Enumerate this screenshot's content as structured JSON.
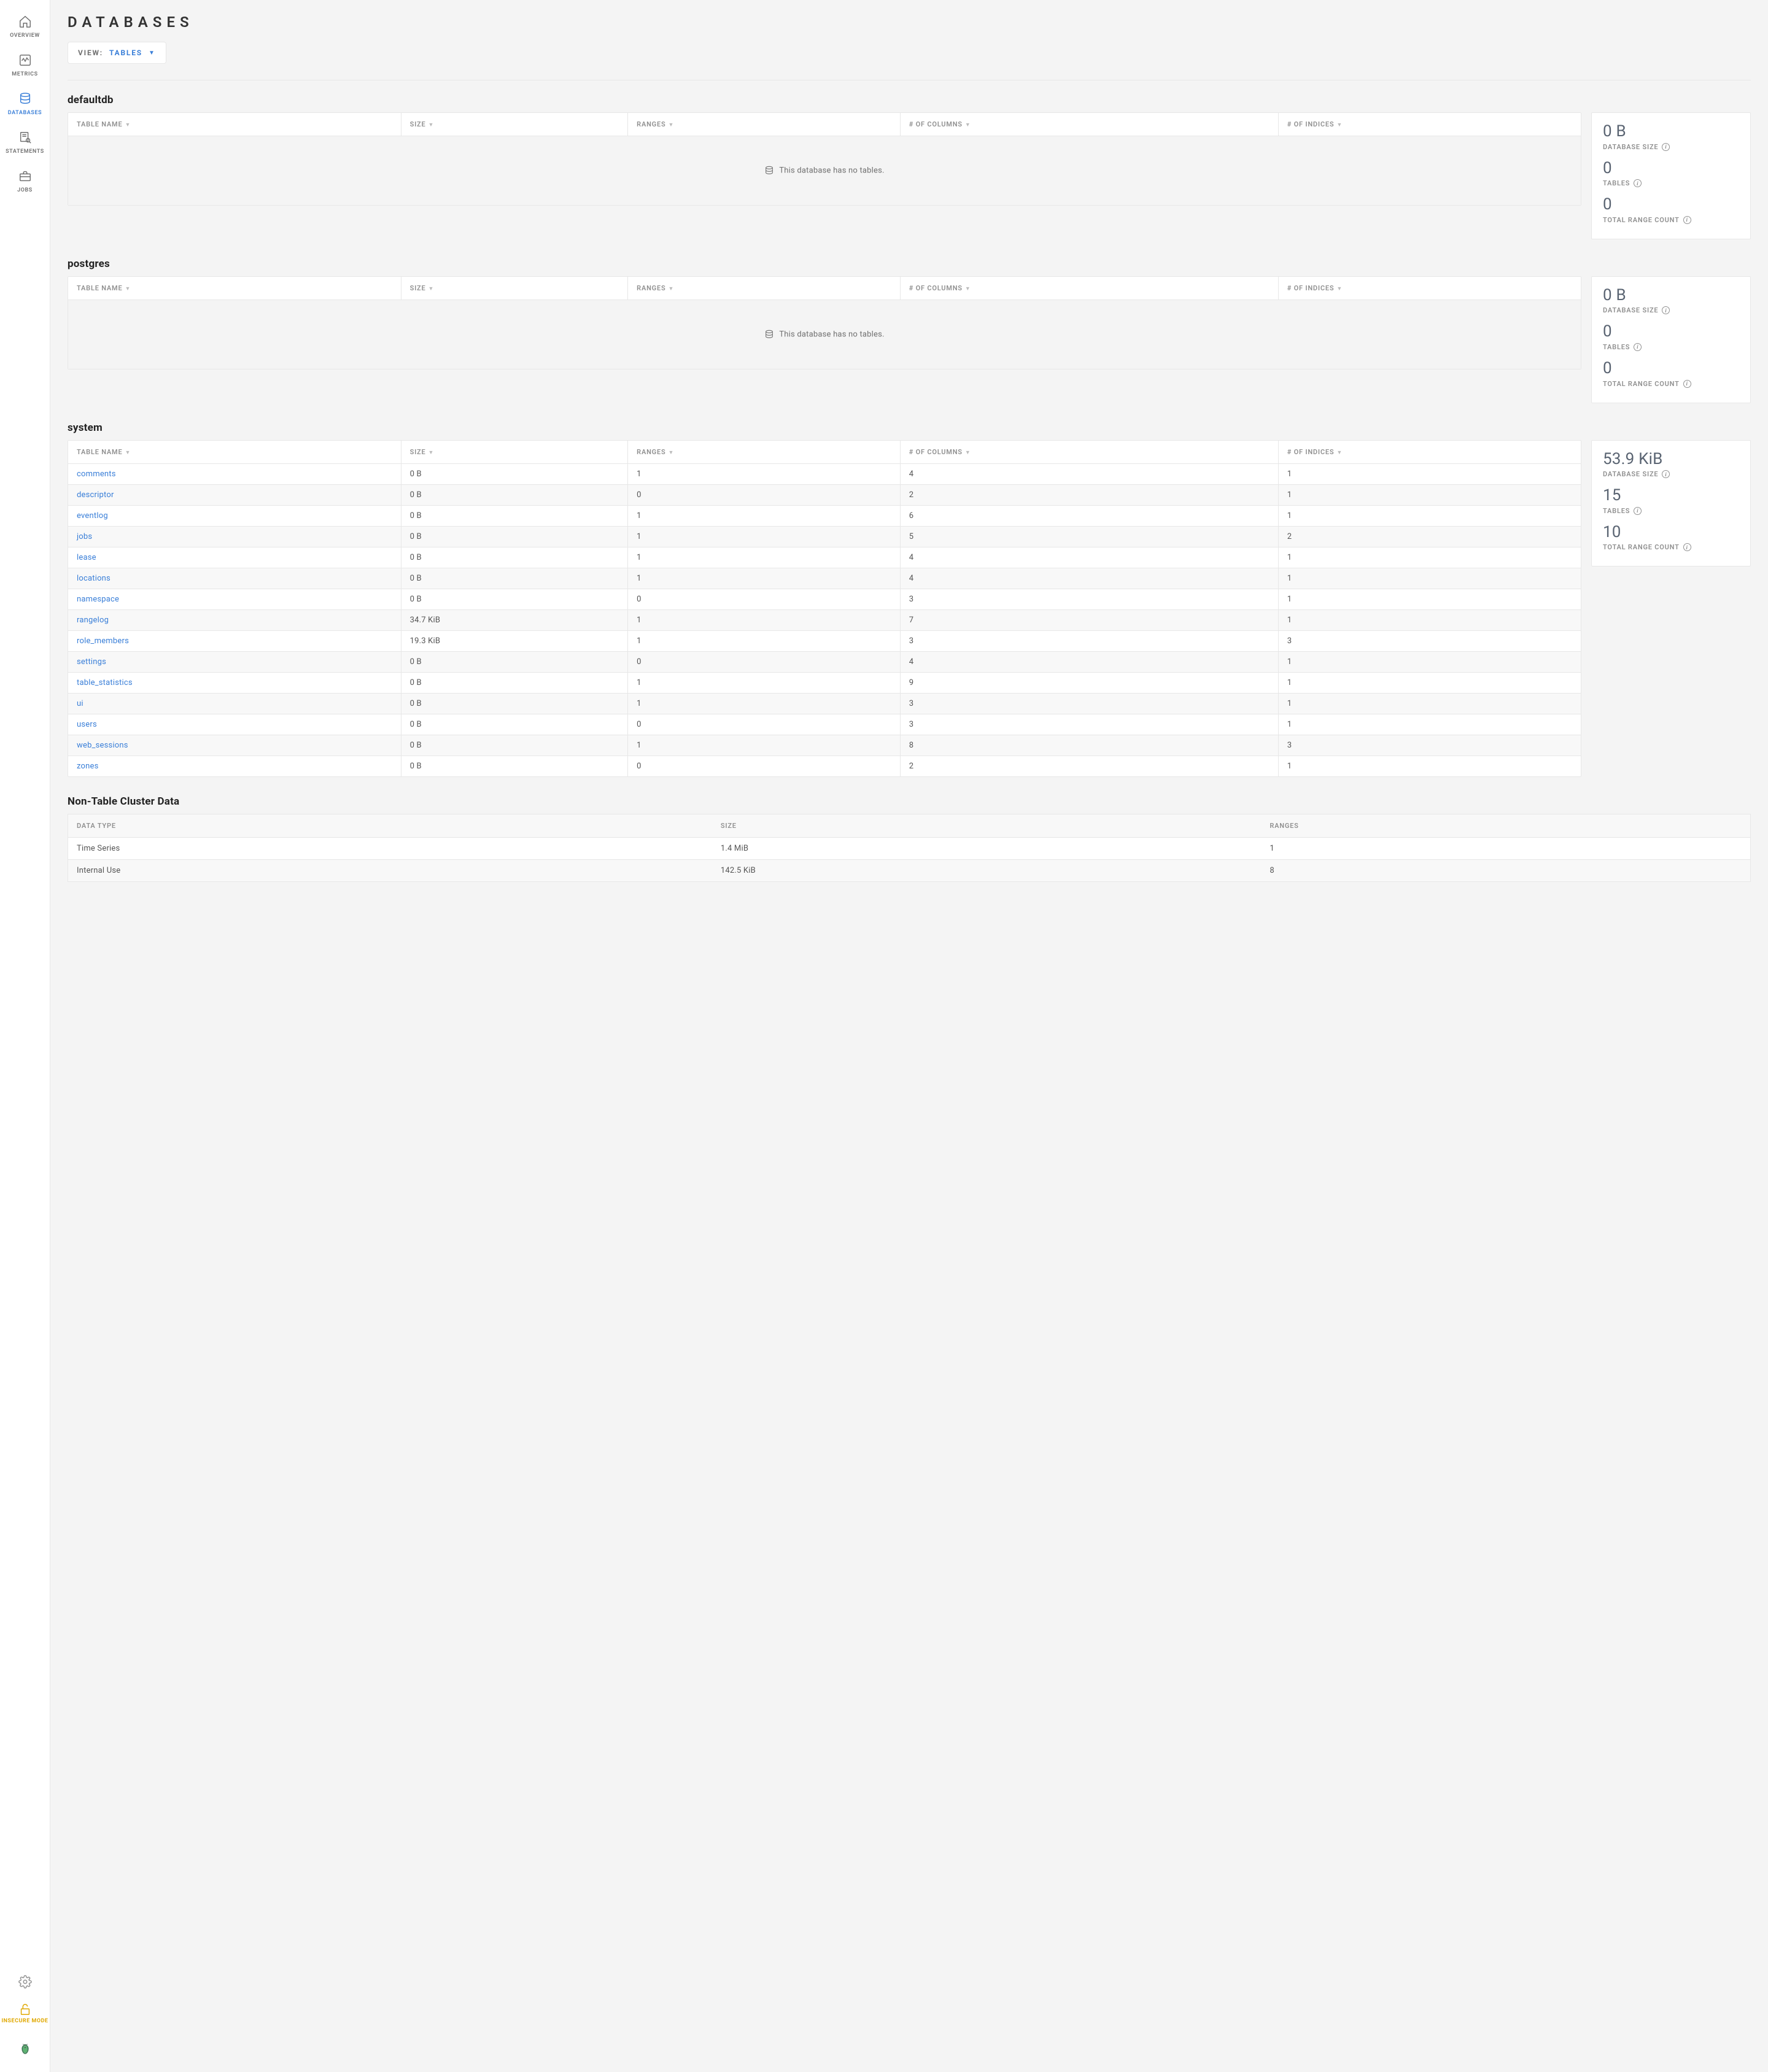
{
  "sidebar": {
    "items": [
      {
        "label": "OVERVIEW",
        "icon": "home"
      },
      {
        "label": "METRICS",
        "icon": "activity"
      },
      {
        "label": "DATABASES",
        "icon": "database",
        "active": true
      },
      {
        "label": "STATEMENTS",
        "icon": "search-doc"
      },
      {
        "label": "JOBS",
        "icon": "briefcase"
      }
    ],
    "footer": {
      "settings_icon": "gear",
      "insecure_label": "INSECURE MODE",
      "insecure_icon": "lock-open"
    }
  },
  "page": {
    "title": "DATABASES",
    "view_label": "VIEW:",
    "view_value": "TABLES"
  },
  "table_columns": [
    "TABLE NAME",
    "SIZE",
    "RANGES",
    "# OF COLUMNS",
    "# OF INDICES"
  ],
  "summary_labels": {
    "size": "DATABASE SIZE",
    "tables": "TABLES",
    "ranges": "TOTAL RANGE COUNT"
  },
  "empty_message": "This database has no tables.",
  "databases": [
    {
      "name": "defaultdb",
      "summary": {
        "size": "0 B",
        "tables": "0",
        "ranges": "0"
      },
      "rows": []
    },
    {
      "name": "postgres",
      "summary": {
        "size": "0 B",
        "tables": "0",
        "ranges": "0"
      },
      "rows": []
    },
    {
      "name": "system",
      "summary": {
        "size": "53.9 KiB",
        "tables": "15",
        "ranges": "10"
      },
      "rows": [
        {
          "name": "comments",
          "size": "0 B",
          "ranges": "1",
          "cols": "4",
          "idx": "1"
        },
        {
          "name": "descriptor",
          "size": "0 B",
          "ranges": "0",
          "cols": "2",
          "idx": "1"
        },
        {
          "name": "eventlog",
          "size": "0 B",
          "ranges": "1",
          "cols": "6",
          "idx": "1"
        },
        {
          "name": "jobs",
          "size": "0 B",
          "ranges": "1",
          "cols": "5",
          "idx": "2"
        },
        {
          "name": "lease",
          "size": "0 B",
          "ranges": "1",
          "cols": "4",
          "idx": "1"
        },
        {
          "name": "locations",
          "size": "0 B",
          "ranges": "1",
          "cols": "4",
          "idx": "1"
        },
        {
          "name": "namespace",
          "size": "0 B",
          "ranges": "0",
          "cols": "3",
          "idx": "1"
        },
        {
          "name": "rangelog",
          "size": "34.7 KiB",
          "ranges": "1",
          "cols": "7",
          "idx": "1"
        },
        {
          "name": "role_members",
          "size": "19.3 KiB",
          "ranges": "1",
          "cols": "3",
          "idx": "3"
        },
        {
          "name": "settings",
          "size": "0 B",
          "ranges": "0",
          "cols": "4",
          "idx": "1"
        },
        {
          "name": "table_statistics",
          "size": "0 B",
          "ranges": "1",
          "cols": "9",
          "idx": "1"
        },
        {
          "name": "ui",
          "size": "0 B",
          "ranges": "1",
          "cols": "3",
          "idx": "1"
        },
        {
          "name": "users",
          "size": "0 B",
          "ranges": "0",
          "cols": "3",
          "idx": "1"
        },
        {
          "name": "web_sessions",
          "size": "0 B",
          "ranges": "1",
          "cols": "8",
          "idx": "3"
        },
        {
          "name": "zones",
          "size": "0 B",
          "ranges": "0",
          "cols": "2",
          "idx": "1"
        }
      ]
    }
  ],
  "cluster_data": {
    "heading": "Non-Table Cluster Data",
    "columns": [
      "DATA TYPE",
      "SIZE",
      "RANGES"
    ],
    "rows": [
      {
        "type": "Time Series",
        "size": "1.4 MiB",
        "ranges": "1"
      },
      {
        "type": "Internal Use",
        "size": "142.5 KiB",
        "ranges": "8"
      }
    ]
  }
}
